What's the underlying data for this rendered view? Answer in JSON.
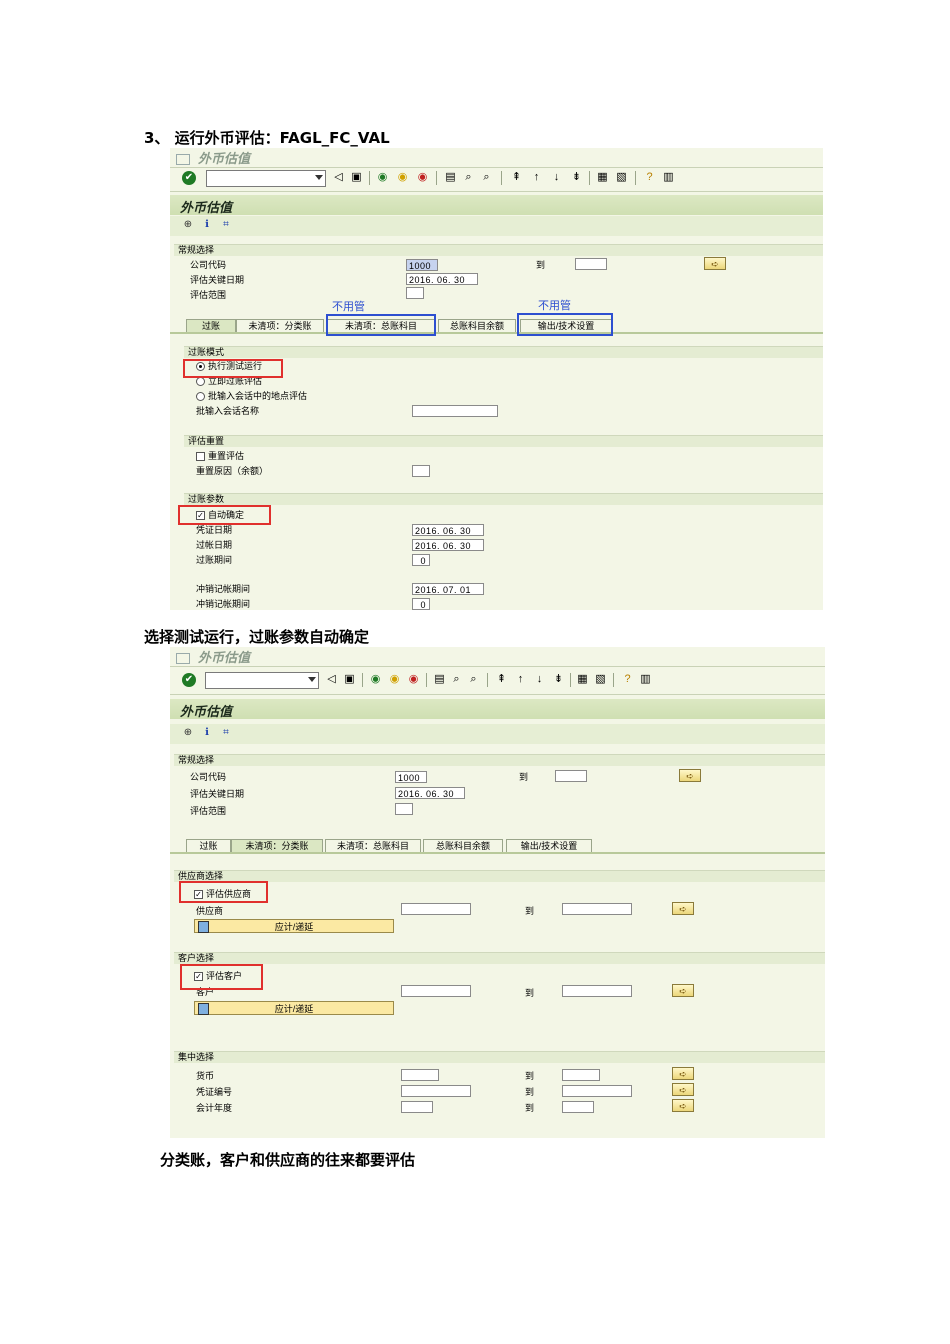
{
  "heading1": "3、 运行外币评估：FAGL_FC_VAL",
  "caption1": "选择测试运行，过账参数自动确定",
  "caption2": "分类账，客户和供应商的往来都要评估",
  "colors": {
    "panel_bg": "#f3f6e6",
    "red_highlight": "#e0302d",
    "blue_highlight": "#2d4fd0"
  },
  "screen1": {
    "window_title": "外币估值",
    "screen_title": "外币估值",
    "general": {
      "header": "常规选择",
      "company_code_label": "公司代码",
      "company_code_value": "1000",
      "to_label": "到",
      "key_date_label": "评估关键日期",
      "key_date_value": "2016. 06. 30",
      "area_label": "评估范围"
    },
    "notes": [
      "不用管",
      "不用管"
    ],
    "tabs": [
      "过账",
      "未清项：分类账",
      "未清项：总账科目",
      "总账科目余额",
      "输出/技术设置"
    ],
    "posting_mode": {
      "header": "过账模式",
      "test_run": "执行测试运行",
      "post_immediately": "立即过账评估",
      "batch_input": "批输入会话中的地点评估",
      "session_name_label": "批输入会话名称"
    },
    "reset": {
      "header": "评估重置",
      "reset_check": "重置评估",
      "reason_label": "重置原因（余额）"
    },
    "posting_params": {
      "header": "过账参数",
      "auto_determine": "自动确定",
      "doc_date_label": "凭证日期",
      "doc_date_value": "2016. 06. 30",
      "post_date_label": "过帐日期",
      "post_date_value": "2016. 06. 30",
      "period_label": "过账期间",
      "period_value": "0",
      "rev_date_label": "冲销记帐期间",
      "rev_date_value": "2016. 07. 01",
      "rev_period_label": "冲销记帐期间",
      "rev_period_value": "0"
    }
  },
  "screen2": {
    "window_title": "外币估值",
    "screen_title": "外币估值",
    "general": {
      "header": "常规选择",
      "company_code_label": "公司代码",
      "company_code_value": "1000",
      "to_label": "到",
      "key_date_label": "评估关键日期",
      "key_date_value": "2016. 06. 30",
      "area_label": "评估范围"
    },
    "tabs": [
      "过账",
      "未清项：分类账",
      "未清项：总账科目",
      "总账科目余额",
      "输出/技术设置"
    ],
    "vendor": {
      "header": "供应商选择",
      "check": "评估供应商",
      "label": "供应商",
      "to_label": "到",
      "button": "应计/递延"
    },
    "customer": {
      "header": "客户选择",
      "check": "评估客户",
      "label": "客户",
      "to_label": "到",
      "button": "应计/递延"
    },
    "central": {
      "header": "集中选择",
      "currency_label": "货币",
      "doc_no_label": "凭证编号",
      "fiscal_year_label": "会计年度",
      "to_label": "到"
    }
  }
}
